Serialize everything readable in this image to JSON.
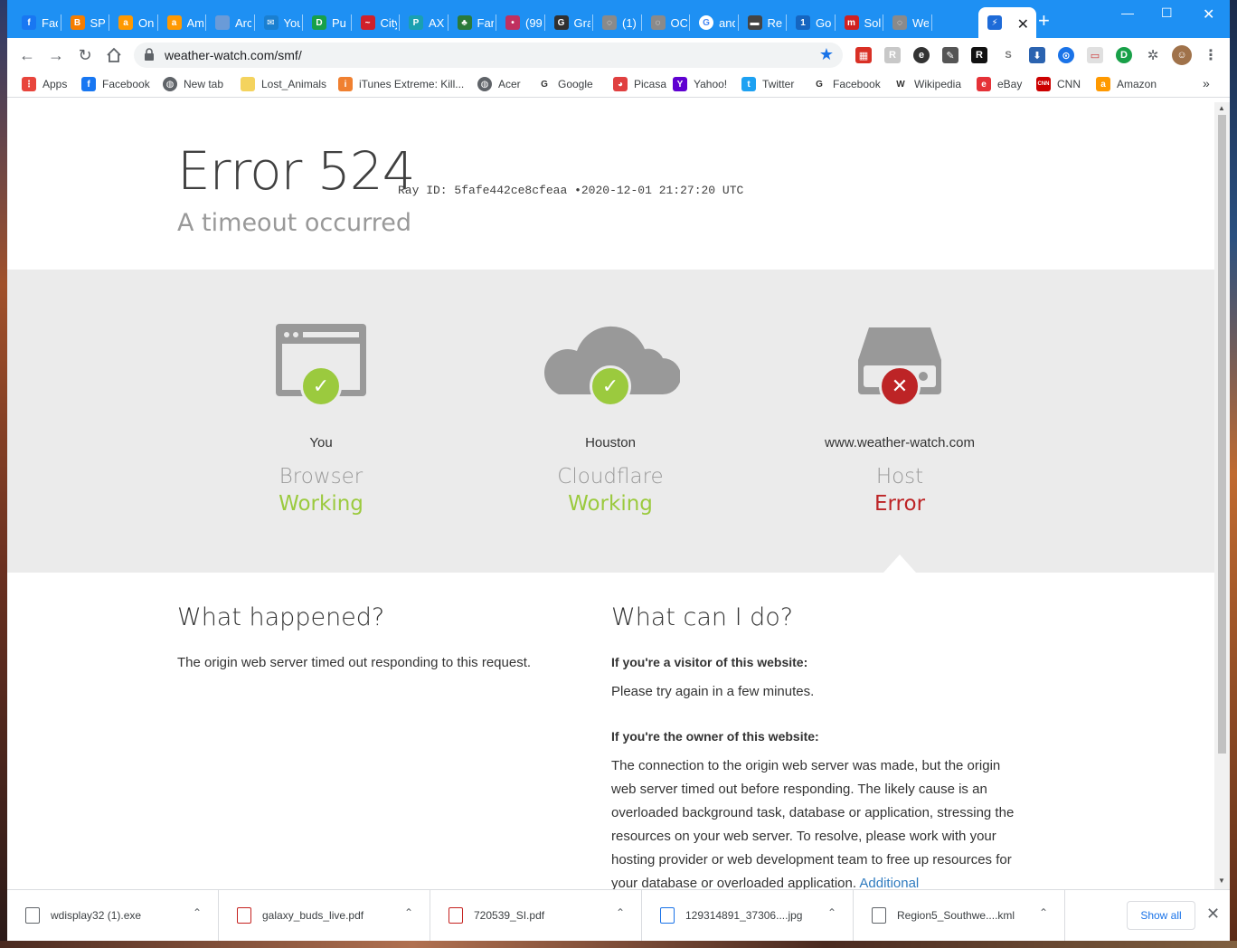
{
  "tabs": [
    {
      "title": "Fac",
      "icon": "facebook-icon",
      "color": "#1877f2",
      "glyph": "f"
    },
    {
      "title": "SPI",
      "icon": "blogger-icon",
      "color": "#f57d00",
      "glyph": "B"
    },
    {
      "title": "On",
      "icon": "amazon-icon",
      "color": "#ff9900",
      "glyph": "a"
    },
    {
      "title": "Am",
      "icon": "amazon-icon",
      "color": "#ff9900",
      "glyph": "a"
    },
    {
      "title": "Arc",
      "icon": "archive-icon",
      "color": "#6a9bd8",
      "glyph": ""
    },
    {
      "title": "You",
      "icon": "mail-icon",
      "color": "#1a7fd0",
      "glyph": "✉"
    },
    {
      "title": "Pu",
      "icon": "pu-icon",
      "color": "#18a048",
      "glyph": "D"
    },
    {
      "title": "City",
      "icon": "city-icon",
      "color": "#d0202a",
      "glyph": "~"
    },
    {
      "title": "AX",
      "icon": "ax-icon",
      "color": "#1aa0b0",
      "glyph": "P"
    },
    {
      "title": "Far",
      "icon": "tree-icon",
      "color": "#2a7a3a",
      "glyph": "♣"
    },
    {
      "title": "(99",
      "icon": "dots-icon",
      "color": "#c03060",
      "glyph": "•"
    },
    {
      "title": "Gra",
      "icon": "gra-icon",
      "color": "#303030",
      "glyph": "G"
    },
    {
      "title": "(1)",
      "icon": "loading-icon",
      "color": "#8a8a8a",
      "glyph": "◌"
    },
    {
      "title": "OC",
      "icon": "loading-icon",
      "color": "#8a8a8a",
      "glyph": "◌"
    },
    {
      "title": "and",
      "icon": "google-icon",
      "color": "#ffffff",
      "glyph": "G"
    },
    {
      "title": "Re",
      "icon": "re-icon",
      "color": "#444444",
      "glyph": "▬"
    },
    {
      "title": "Go",
      "icon": "go-icon",
      "color": "#1565c0",
      "glyph": "1"
    },
    {
      "title": "Sol",
      "icon": "sol-icon",
      "color": "#d02020",
      "glyph": "m"
    },
    {
      "title": "We",
      "icon": "loading-icon",
      "color": "#8a8a8a",
      "glyph": "◌"
    },
    {
      "title": "",
      "icon": "cloudflare-icon",
      "color": "#1e6bd8",
      "glyph": "⚡"
    }
  ],
  "active_tab_index": 19,
  "address": {
    "url": "weather-watch.com/smf/"
  },
  "bookmarks": [
    {
      "label": "Apps",
      "icon": "apps-grid-icon",
      "color": "#e8453c",
      "glyph": "⋮"
    },
    {
      "label": "Facebook",
      "icon": "facebook-icon",
      "color": "#1877f2",
      "glyph": "f"
    },
    {
      "label": "New tab",
      "icon": "globe-icon",
      "color": "#5f6368",
      "glyph": "◍"
    },
    {
      "label": "Lost_Animals",
      "icon": "folder-icon",
      "color": "#f4d35e",
      "glyph": ""
    },
    {
      "label": "iTunes Extreme: Kill...",
      "icon": "itunes-icon",
      "color": "#f08030",
      "glyph": "i"
    },
    {
      "label": "Acer",
      "icon": "globe-icon",
      "color": "#5f6368",
      "glyph": "◍"
    },
    {
      "label": "Google",
      "icon": "google-icon",
      "color": "#ffffff",
      "glyph": "G"
    },
    {
      "label": "Picasa",
      "icon": "picasa-icon",
      "color": "#e04040",
      "glyph": "◕"
    },
    {
      "label": "Yahoo!",
      "icon": "yahoo-icon",
      "color": "#5f01d1",
      "glyph": "Y"
    },
    {
      "label": "Twitter",
      "icon": "twitter-icon",
      "color": "#1da1f2",
      "glyph": "t"
    },
    {
      "label": "Facebook",
      "icon": "google-icon",
      "color": "#ffffff",
      "glyph": "G"
    },
    {
      "label": "Wikipedia",
      "icon": "wikipedia-icon",
      "color": "#ffffff",
      "glyph": "W"
    },
    {
      "label": "eBay",
      "icon": "ebay-icon",
      "color": "#e53238",
      "glyph": "e"
    },
    {
      "label": "CNN",
      "icon": "cnn-icon",
      "color": "#cc0000",
      "glyph": "CNN"
    },
    {
      "label": "Amazon",
      "icon": "amazon-icon",
      "color": "#ff9900",
      "glyph": "a"
    }
  ],
  "page": {
    "error_title": "Error 524",
    "ray_label": "Ray ID:",
    "ray_id": "5fafe442ce8cfeaa",
    "ray_sep": "•",
    "timestamp": "2020-12-01 21:27:20 UTC",
    "subtitle": "A timeout occurred",
    "columns": [
      {
        "location": "You",
        "kind": "Browser",
        "state": "Working",
        "ok": true
      },
      {
        "location": "Houston",
        "kind": "Cloudflare",
        "state": "Working",
        "ok": true
      },
      {
        "location": "www.weather-watch.com",
        "kind": "Host",
        "state": "Error",
        "ok": false
      }
    ],
    "what_happened": {
      "heading": "What happened?",
      "text": "The origin web server timed out responding to this request."
    },
    "what_can_i_do": {
      "heading": "What can I do?",
      "visitor_heading": "If you're a visitor of this website:",
      "visitor_text": "Please try again in a few minutes.",
      "owner_heading": "If you're the owner of this website:",
      "owner_text_lines": [
        "The connection to the origin web server was made, but the origin",
        "web server timed out before responding. The likely cause is an",
        "overloaded background task, database or application, stressing the",
        "resources on your web server. To resolve, please work with your",
        "hosting provider or web development team to free up resources for",
        "your database or overloaded application."
      ],
      "additional_link": "Additional"
    },
    "colors": {
      "ok": "#9bca3e",
      "error": "#bd2426",
      "link": "#2f7bbf"
    }
  },
  "downloads": [
    {
      "name": "wdisplay32 (1).exe",
      "icon": "exe-icon"
    },
    {
      "name": "galaxy_buds_live.pdf",
      "icon": "pdf-icon"
    },
    {
      "name": "720539_SI.pdf",
      "icon": "pdf-icon"
    },
    {
      "name": "129314891_37306....jpg",
      "icon": "image-file-icon"
    },
    {
      "name": "Region5_Southwe....kml",
      "icon": "globe-file-icon"
    }
  ],
  "show_all_label": "Show all"
}
